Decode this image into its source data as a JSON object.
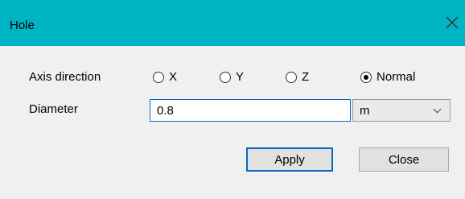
{
  "window": {
    "title": "Hole"
  },
  "form": {
    "axis_label": "Axis direction",
    "axis_options": [
      {
        "label": "X",
        "checked": false
      },
      {
        "label": "Y",
        "checked": false
      },
      {
        "label": "Z",
        "checked": false
      },
      {
        "label": "Normal",
        "checked": true
      }
    ],
    "diameter_label": "Diameter",
    "diameter_value": "0.8",
    "unit_value": "m"
  },
  "buttons": {
    "apply": "Apply",
    "close": "Close"
  },
  "colors": {
    "titlebar": "#00b5c3",
    "focus": "#0a66c2"
  },
  "icons": {
    "close": "close-icon",
    "dropdown": "chevron-down-icon"
  }
}
